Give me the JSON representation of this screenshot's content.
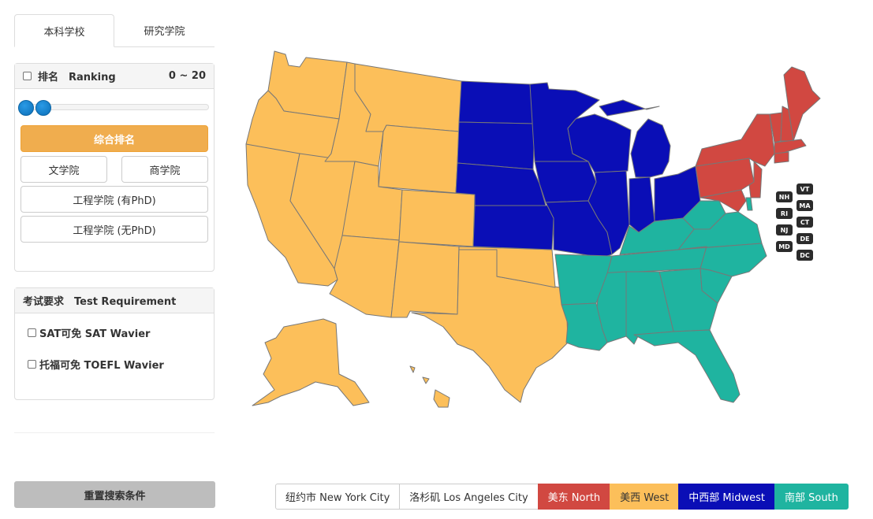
{
  "tabs": [
    {
      "label": "本科学校",
      "active": true
    },
    {
      "label": "研究学院",
      "active": false
    }
  ],
  "ranking": {
    "title": "排名　Ranking",
    "range": "0 ~ 20",
    "slider_min": 0,
    "slider_max": 20,
    "buttons": {
      "overall": "综合排名",
      "arts": "文学院",
      "business": "商学院",
      "eng_phd": "工程学院 (有PhD)",
      "eng_nophd": "工程学院 (无PhD)"
    }
  },
  "test": {
    "title": "考试要求　Test Requirement",
    "options": [
      "SAT可免 SAT Wavier",
      "托福可免 TOEFL Wavier"
    ]
  },
  "reset_label": "重置搜索条件",
  "small_states": {
    "left": [
      "NH",
      "RI",
      "NJ",
      "MD"
    ],
    "right": [
      "VT",
      "MA",
      "CT",
      "DE",
      "DC"
    ]
  },
  "legend": [
    {
      "label": "纽约市 New York City",
      "bg": "#ffffff",
      "fg": "#333333"
    },
    {
      "label": "洛杉矶 Los Angeles City",
      "bg": "#ffffff",
      "fg": "#333333"
    },
    {
      "label": "美东 North",
      "bg": "#d14841",
      "fg": "#ffffff"
    },
    {
      "label": "美西 West",
      "bg": "#fcbf5a",
      "fg": "#333333"
    },
    {
      "label": "中西部 Midwest",
      "bg": "#0a0eb6",
      "fg": "#ffffff"
    },
    {
      "label": "南部 South",
      "bg": "#1fb4a0",
      "fg": "#ffffff"
    }
  ],
  "region_colors": {
    "west": "#fcbf5a",
    "midwest": "#0a0eb6",
    "north": "#d14841",
    "south": "#1fb4a0"
  }
}
